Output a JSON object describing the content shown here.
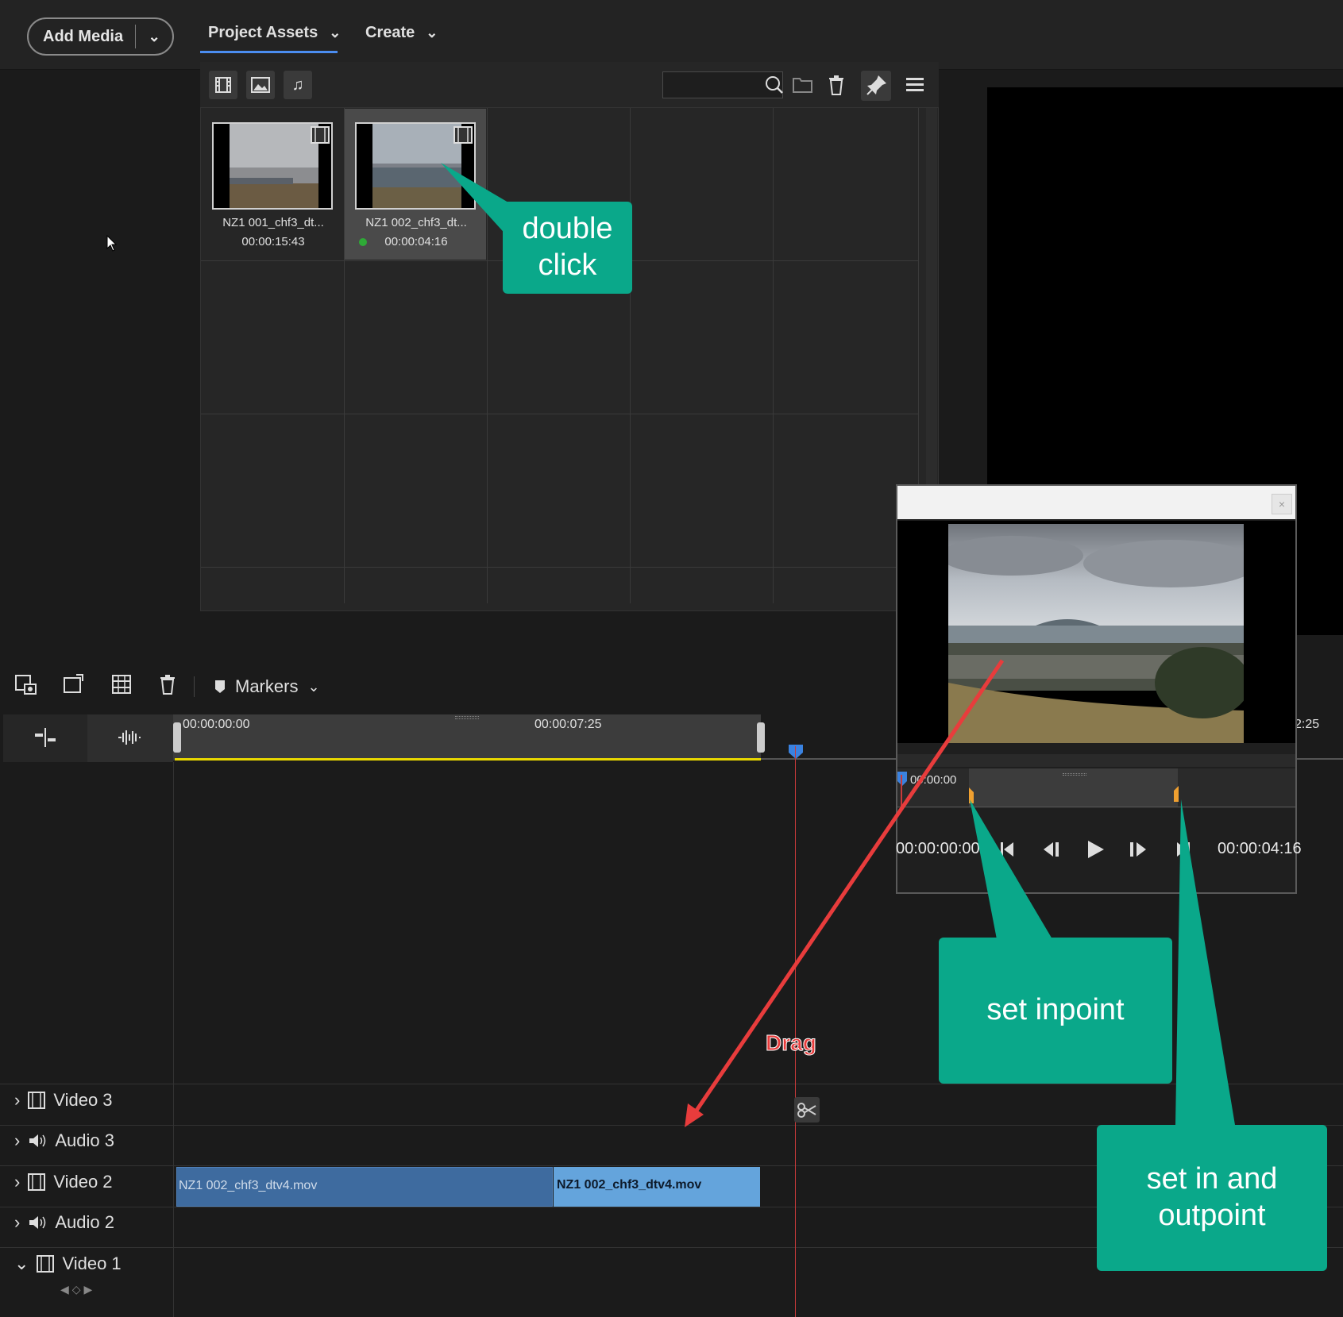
{
  "topbar": {
    "add_media": "Add Media",
    "tab_project_assets": "Project Assets",
    "tab_create": "Create"
  },
  "assets": {
    "items": [
      {
        "name": "NZ1 001_chf3_dt...",
        "duration": "00:00:15:43"
      },
      {
        "name": "NZ1 002_chf3_dt...",
        "duration": "00:00:04:16"
      }
    ]
  },
  "preview": {
    "scrub_timecode": "00:00:00",
    "in_timecode": "00:00:00:00",
    "out_timecode": "00:00:04:16"
  },
  "timeline": {
    "markers_label": "Markers",
    "ruler_start": "00:00:00:00",
    "ruler_mid": "00:00:07:25",
    "ruler_right": "2:25",
    "tracks": [
      "Video 3",
      "Audio 3",
      "Video 2",
      "Audio 2",
      "Video 1"
    ],
    "clip1_name": "NZ1 002_chf3_dtv4.mov",
    "clip2_name": "NZ1 002_chf3_dtv4.mov"
  },
  "annotations": {
    "double_click": "double\nclick",
    "drag": "Drag",
    "set_inpoint": "set inpoint",
    "set_in_out": "set in and\noutpoint"
  },
  "colors": {
    "accent": "#4b8df0",
    "callout": "#0aa88a",
    "arrow": "#e83c3c",
    "clip_primary": "#3e6b9f",
    "clip_selected": "#64a4dc",
    "ruler_work_area": "#e9d800"
  }
}
